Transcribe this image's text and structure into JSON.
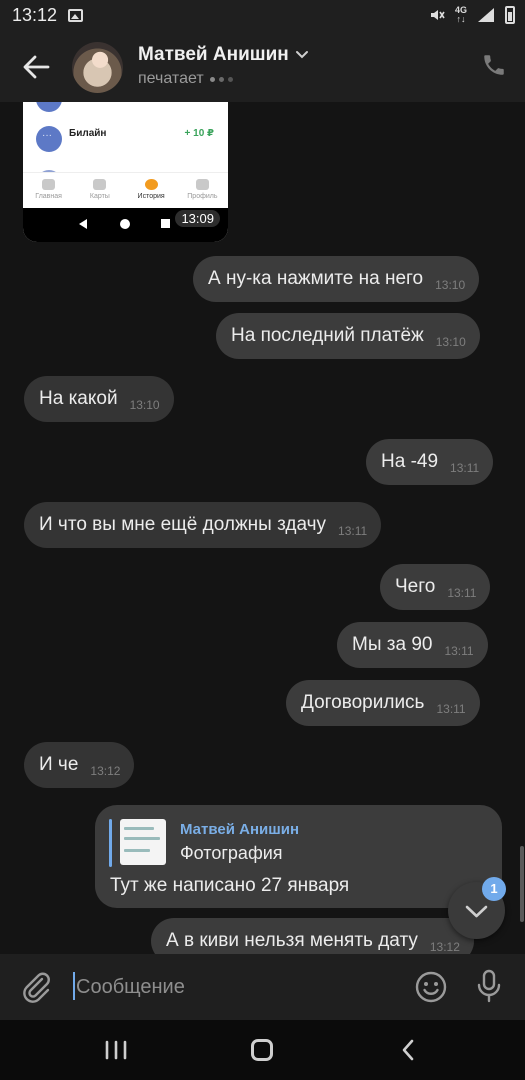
{
  "status_bar": {
    "time": "13:12",
    "network": "4G",
    "network_sub": "↑↓",
    "icons": [
      "image-icon",
      "mute-icon",
      "signal-icon",
      "battery-icon"
    ]
  },
  "header": {
    "contact_name": "Матвей Анишин",
    "status": "печатает"
  },
  "attachment": {
    "rows": [
      {
        "label": "Билайн",
        "amount": "+ 10 ₽"
      }
    ],
    "tabs": [
      "Главная",
      "Карты",
      "История",
      "Профиль"
    ],
    "active_tab": "История",
    "time": "13:09"
  },
  "messages": [
    {
      "text": "А ну-ка нажмите на него",
      "time": "13:10",
      "direction": "out"
    },
    {
      "text": "На последний платёж",
      "time": "13:10",
      "direction": "out"
    },
    {
      "text": "На какой",
      "time": "13:10",
      "direction": "in"
    },
    {
      "text": "На -49",
      "time": "13:11",
      "direction": "out"
    },
    {
      "text": "И что вы мне ещё должны здачу",
      "time": "13:11",
      "direction": "in"
    },
    {
      "text": "Чего",
      "time": "13:11",
      "direction": "out"
    },
    {
      "text": "Мы за 90",
      "time": "13:11",
      "direction": "out"
    },
    {
      "text": "Договорились",
      "time": "13:11",
      "direction": "out"
    },
    {
      "text": "И че",
      "time": "13:12",
      "direction": "in"
    },
    {
      "text": "А в киви нельзя менять дату",
      "time": "13:12",
      "direction": "out"
    }
  ],
  "reply": {
    "quoted_author": "Матвей Анишин",
    "quoted_text": "Фотография",
    "text": "Тут же написано 27 января"
  },
  "scroll_fab": {
    "unread_count": "1"
  },
  "composer": {
    "placeholder": "Сообщение"
  },
  "colors": {
    "accent": "#71aaeb",
    "background": "#141414",
    "bubble_in": "#343434",
    "bubble_out": "#3c3c3c",
    "amount_green": "#3aa35b"
  }
}
